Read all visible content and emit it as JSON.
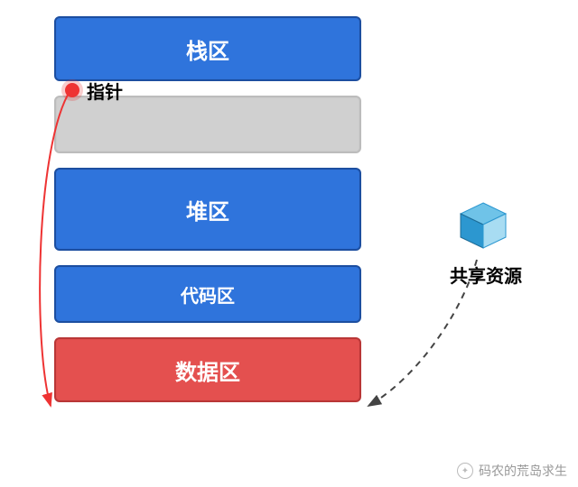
{
  "blocks": {
    "stack_area": "栈区",
    "heap_area": "堆区",
    "code_area": "代码区",
    "data_area": "数据区"
  },
  "labels": {
    "pointer": "指针",
    "shared_resource": "共享资源"
  },
  "watermark": {
    "text": "码农的荒岛求生"
  },
  "colors": {
    "blue": "#2f74dc",
    "grey": "#d0d0d0",
    "red": "#e4504f",
    "cube": "#2c97d0"
  }
}
